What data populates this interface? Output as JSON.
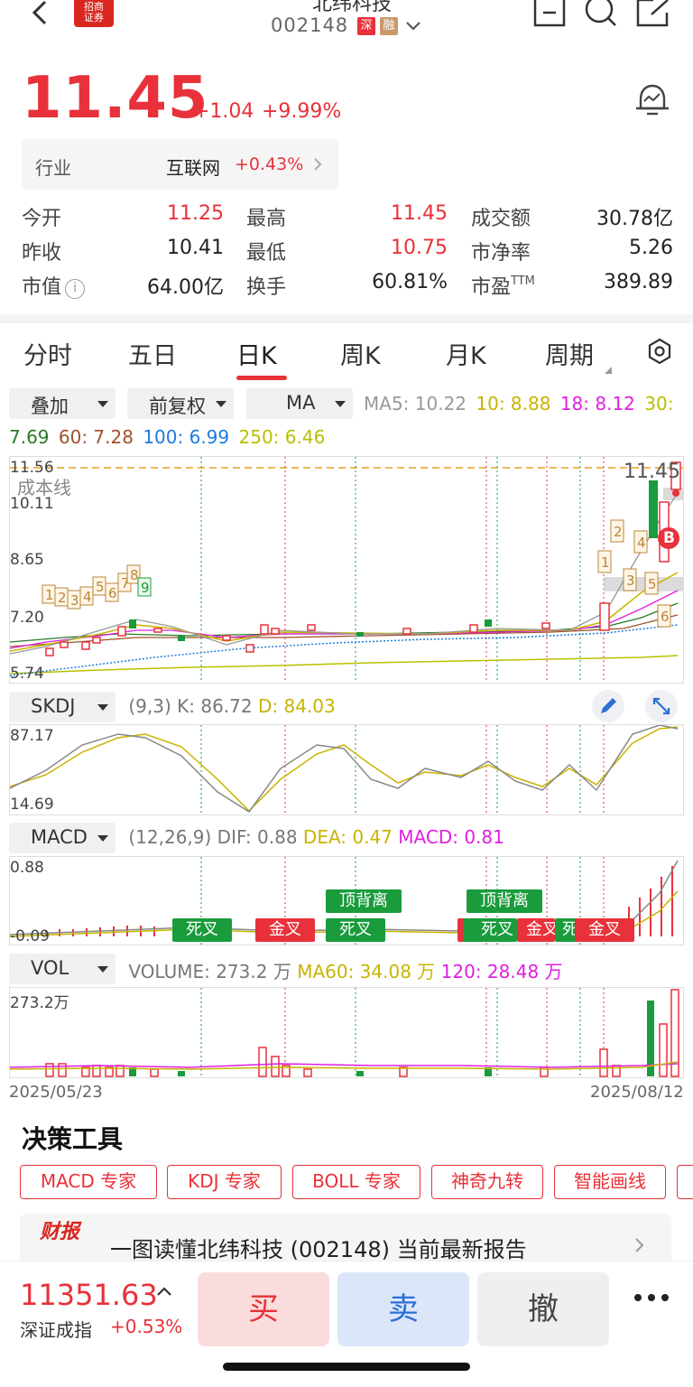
{
  "header": {
    "title": "北纬科技",
    "code": "002148",
    "tag_market": "深",
    "tag_margin": "融",
    "logo_text": "招商证券"
  },
  "quote": {
    "price": "11.45",
    "change": "+1.04",
    "change_pct": "+9.99%"
  },
  "industry": {
    "label": "行业",
    "name": "互联网",
    "pct": "+0.43%"
  },
  "stats": {
    "open_label": "今开",
    "open": "11.25",
    "high_label": "最高",
    "high": "11.45",
    "amount_label": "成交额",
    "amount": "30.78亿",
    "prev_label": "昨收",
    "prev": "10.41",
    "low_label": "最低",
    "low": "10.75",
    "pb_label": "市净率",
    "pb": "5.26",
    "mcap_label": "市值",
    "mcap": "64.00亿",
    "turnover_label": "换手",
    "turnover": "60.81%",
    "pe_label": "市盈",
    "pe_sup": "TTM",
    "pe": "389.89"
  },
  "tabs": [
    "分时",
    "五日",
    "日K",
    "周K",
    "月K",
    "周期"
  ],
  "active_tab": "日K",
  "controls": {
    "overlay": "叠加",
    "adjust": "前复权",
    "indicator": "MA"
  },
  "ma": {
    "ma5": "MA5: 10.22",
    "ma10": "10: 8.88",
    "ma18": "18: 8.12",
    "ma30_label": "30:",
    "ma30": "7.69",
    "ma60": "60: 7.28",
    "ma100": "100: 6.99",
    "ma250": "250: 6.46"
  },
  "kline": {
    "y_top": "11.56",
    "y_2": "10.11",
    "y_3": "8.65",
    "y_4": "7.20",
    "y_bottom": "5.74",
    "cost_line_label": "成本线",
    "last_price_label": "11.45",
    "buy_marker": "B"
  },
  "skdj": {
    "name": "SKDJ",
    "params": "(9,3)",
    "k": "K: 86.72",
    "d": "D: 84.03",
    "y_top": "87.17",
    "y_bottom": "14.69"
  },
  "macd": {
    "name": "MACD",
    "params": "(12,26,9)",
    "dif": "DIF: 0.88",
    "dea": "DEA: 0.47",
    "macd": "MACD: 0.81",
    "y_top": "0.88",
    "y_bottom": "-0.09",
    "signals": {
      "dead1": "死叉",
      "gold1": "金叉",
      "top1": "顶背离",
      "dead2": "死叉",
      "top2": "顶背离",
      "dead3": "死叉",
      "gold2": "金叉",
      "dead4": "死叉",
      "gold3": "金叉"
    }
  },
  "vol": {
    "name": "VOL",
    "volume": "VOLUME: 273.2 万",
    "ma60": "MA60: 34.08 万",
    "ma120": "120: 28.48 万",
    "y_top": "273.2万"
  },
  "dates": {
    "start": "2025/05/23",
    "end": "2025/08/12"
  },
  "decision_title": "决策工具",
  "tools": [
    "MACD 专家",
    "KDJ 专家",
    "BOLL 专家",
    "神奇九转",
    "智能画线"
  ],
  "report": {
    "logo": "财报",
    "text": "一图读懂北纬科技 (002148) 当前最新报告"
  },
  "index": {
    "value": "11351.63",
    "name": "深证成指",
    "pct": "+0.53%"
  },
  "trade": {
    "buy": "买",
    "sell": "卖",
    "cancel": "撤"
  },
  "colors": {
    "up": "#e8313a",
    "down": "#1a9b3c",
    "ma5": "#999999",
    "ma10": "#c8b400",
    "ma18": "#e020e0",
    "ma30": "#2a7a2a",
    "ma60": "#a0522d",
    "ma100": "#1e7be0",
    "ma250": "#b8c000"
  }
}
